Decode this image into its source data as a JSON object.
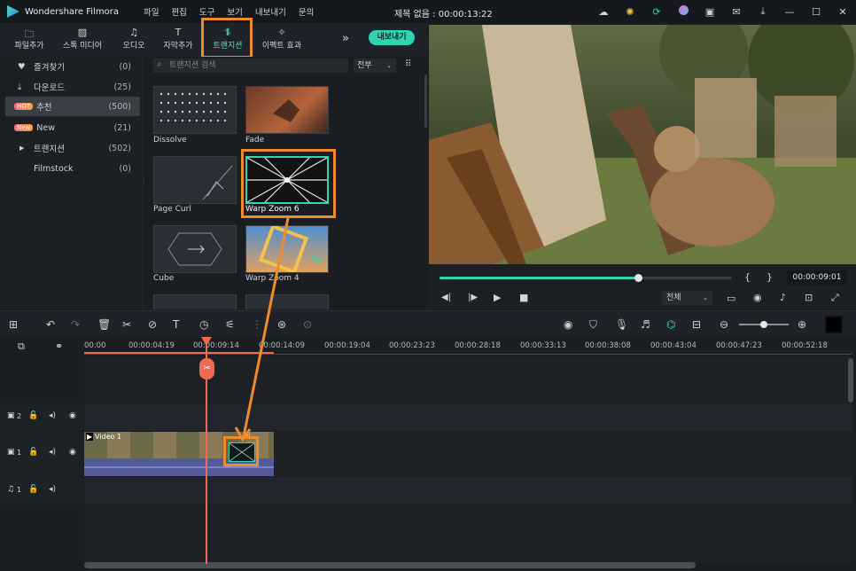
{
  "app": {
    "name": "Wondershare Filmora",
    "window_title": "제목 없음 : 00:00:13:22",
    "menu": [
      "파일",
      "편집",
      "도구",
      "보기",
      "내보내기",
      "문의"
    ]
  },
  "toolbar": {
    "tools": [
      {
        "label": "파일추가",
        "icon": "folder-icon"
      },
      {
        "label": "스톡 미디어",
        "icon": "image-icon"
      },
      {
        "label": "오디오",
        "icon": "music-icon"
      },
      {
        "label": "자막추가",
        "icon": "text-icon"
      },
      {
        "label": "트랜지션",
        "icon": "transition-icon"
      },
      {
        "label": "이펙트 효과",
        "icon": "effects-icon"
      }
    ],
    "export_label": "내보내기"
  },
  "sidebar": {
    "items": [
      {
        "label": "즐겨찾기",
        "count": "(0)",
        "icon": "heart-icon"
      },
      {
        "label": "다운로드",
        "count": "(25)",
        "icon": "download-icon"
      },
      {
        "label": "추천",
        "count": "(500)",
        "badge": "HOT"
      },
      {
        "label": "New",
        "count": "(21)",
        "badge": "New"
      },
      {
        "label": "트랜지션",
        "count": "(502)",
        "icon": "expand-arrow-icon"
      },
      {
        "label": "Filmstock",
        "count": "(0)"
      }
    ]
  },
  "browser": {
    "search_placeholder": "트랜지션 검색",
    "filter_label": "전부",
    "items": [
      "Dissolve",
      "Fade",
      "Page Curl",
      "Warp Zoom 6",
      "Cube",
      "Warp Zoom 4"
    ]
  },
  "player": {
    "progress": 0.68,
    "timecode": "00:00:09:01",
    "quality": "전체",
    "brackets": [
      "{",
      "}"
    ]
  },
  "timeline": {
    "ruler": [
      "00:00",
      "00:00:04:19",
      "00:00:09:14",
      "00:00:14:09",
      "00:00:19:04",
      "00:00:23:23",
      "00:00:28:18",
      "00:00:33:13",
      "00:00:38:08",
      "00:00:43:04",
      "00:00:47:23",
      "00:00:52:18"
    ],
    "tracks": [
      {
        "label": "2",
        "type": "video"
      },
      {
        "label": "1",
        "type": "video"
      },
      {
        "label": "1",
        "type": "audio"
      }
    ],
    "clip_label": "Video 1",
    "clip_label2": "Vi..."
  },
  "colors": {
    "accent": "#2fd5b3",
    "highlight": "#f08b2c",
    "playhead": "#f06b50"
  }
}
